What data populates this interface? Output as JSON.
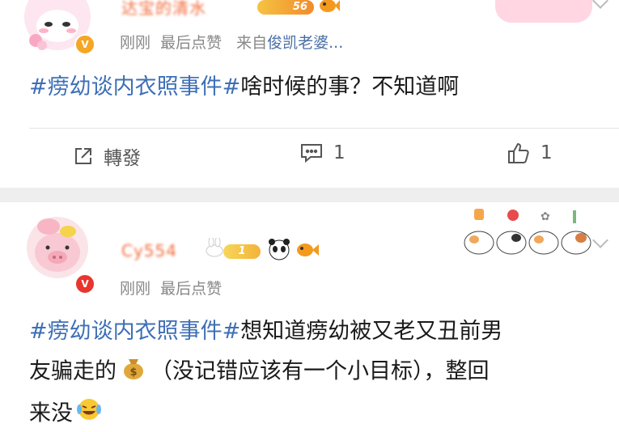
{
  "posts": [
    {
      "username": "达宝的清水",
      "level": "56",
      "timestamp": "刚刚",
      "like_hint": "最后点赞",
      "source_prefix": "来自",
      "source_name": "俊凯老婆...",
      "tag": "#痨幼谈内衣照事件#",
      "text": "啥时候的事？不知道啊",
      "repost_label": "轉發",
      "comment_count": "1",
      "like_count": "1"
    },
    {
      "username": "Cy554",
      "level": "1",
      "timestamp": "刚刚",
      "like_hint": "最后点赞",
      "tag": "#痨幼谈内衣照事件#",
      "text_line1": "想知道痨幼被又老又丑前男",
      "text_line2a": "友骗走的",
      "text_line2b": "（没记错应该有一个小目标），整回",
      "text_line3": "来没"
    }
  ],
  "colors": {
    "tag": "#3d6fb6",
    "name": "#f26b3a",
    "meta": "#888888",
    "divider": "#eeeeee"
  }
}
